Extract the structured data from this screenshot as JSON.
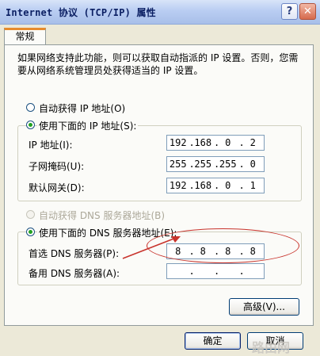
{
  "window": {
    "title": "Internet 协议 (TCP/IP) 属性",
    "help_label": "?",
    "close_label": "✕"
  },
  "tabs": [
    {
      "label": "常规"
    }
  ],
  "description": "如果网络支持此功能，则可以获取自动指派的 IP 设置。否则，您需要从网络系统管理员处获得适当的 IP 设置。",
  "ip_section": {
    "auto_radio": {
      "label": "自动获得 IP 地址(O)",
      "selected": false
    },
    "manual_radio": {
      "label": "使用下面的 IP 地址(S):",
      "selected": true
    },
    "ip_address": {
      "label": "IP 地址(I):",
      "octets": [
        "192",
        "168",
        "0",
        "2"
      ]
    },
    "subnet_mask": {
      "label": "子网掩码(U):",
      "octets": [
        "255",
        "255",
        "255",
        "0"
      ]
    },
    "gateway": {
      "label": "默认网关(D):",
      "octets": [
        "192",
        "168",
        "0",
        "1"
      ]
    }
  },
  "dns_section": {
    "auto_radio": {
      "label": "自动获得 DNS 服务器地址(B)",
      "selected": false,
      "disabled": true
    },
    "manual_radio": {
      "label": "使用下面的 DNS 服务器地址(E):",
      "selected": true
    },
    "preferred": {
      "label": "首选 DNS 服务器(P):",
      "octets": [
        "8",
        "8",
        "8",
        "8"
      ]
    },
    "alternate": {
      "label": "备用 DNS 服务器(A):",
      "octets": [
        "",
        "",
        "",
        ""
      ]
    }
  },
  "buttons": {
    "advanced": "高级(V)...",
    "ok": "确定",
    "cancel": "取消"
  },
  "watermark": "路由网",
  "colors": {
    "annotation": "#c8332c",
    "title_text": "#0b1f63",
    "dialog_bg": "#ece9d8"
  }
}
